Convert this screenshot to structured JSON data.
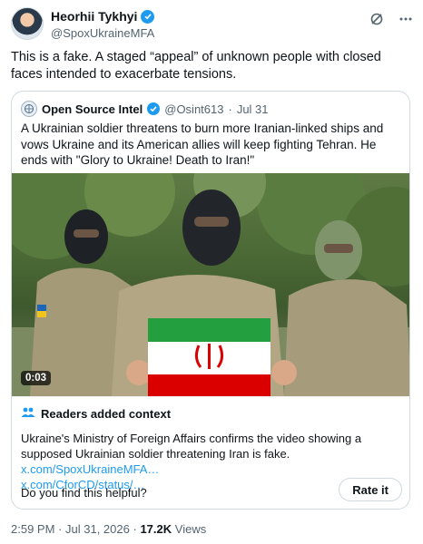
{
  "author": {
    "name": "Heorhii Tykhyi",
    "handle": "@SpoxUkraineMFA"
  },
  "tweet": {
    "text": "This is a fake. A staged “appeal” of unknown people with closed faces intended to exacerbate tensions."
  },
  "quote": {
    "name": "Open Source Intel",
    "handle": "@Osint613",
    "separator": "·",
    "date": "Jul 31",
    "text": "A Ukrainian soldier threatens to burn more Iranian-linked ships and vows Ukraine and its American allies will keep fighting Tehran. He ends with \"Glory to Ukraine! Death to Iran!\"",
    "video_time": "0:03"
  },
  "context": {
    "title": "Readers added context",
    "body": "Ukraine's Ministry of Foreign Affairs confirms the video showing a supposed Ukrainian soldier threatening Iran is fake. ",
    "link1": "x.com/SpoxUkraineMFA…",
    "link2": "x.com/CforCD/status/…",
    "helpful_q": "Do you find this helpful?",
    "rate_label": "Rate it"
  },
  "meta": {
    "time": "2:59 PM",
    "separator": "·",
    "date": "Jul 31, 2026",
    "views": "17.2K",
    "views_label": "Views"
  },
  "colors": {
    "accent": "#1d9bf0",
    "muted": "#536471",
    "flag_green": "#239f40",
    "flag_red": "#da0000"
  }
}
